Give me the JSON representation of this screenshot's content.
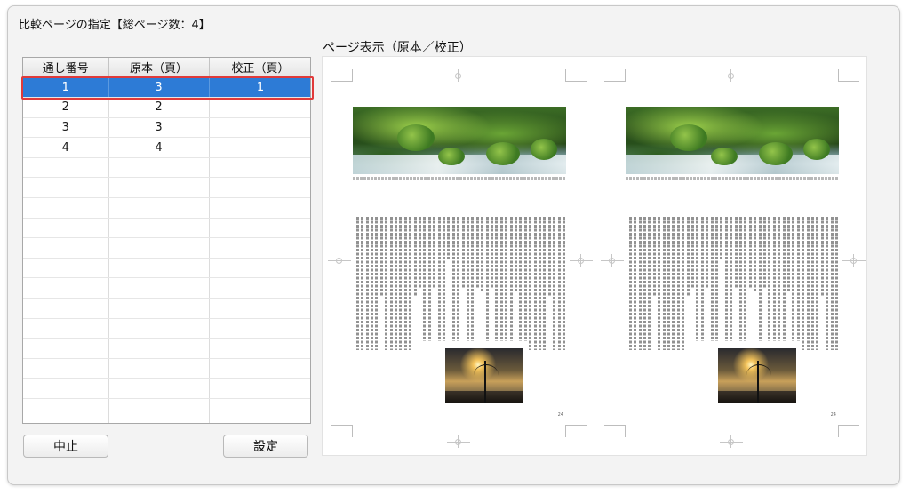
{
  "dialog": {
    "title": "比較ページの指定【総ページ数：4】",
    "preview_label": "ページ表示（原本／校正）"
  },
  "table": {
    "headers": [
      "通し番号",
      "原本（頁）",
      "校正（頁）"
    ],
    "rows": [
      [
        "1",
        "3",
        "1"
      ],
      [
        "2",
        "2",
        ""
      ],
      [
        "3",
        "3",
        ""
      ],
      [
        "4",
        "4",
        ""
      ]
    ],
    "selected_row": 0,
    "empty_rows": 14
  },
  "buttons": {
    "cancel": "中止",
    "set": "設定"
  },
  "preview": {
    "page_number": "24"
  },
  "colors": {
    "selection": "#2d7bd6",
    "selection_outline": "#e03a3a",
    "window_bg": "#f3f3f3"
  }
}
